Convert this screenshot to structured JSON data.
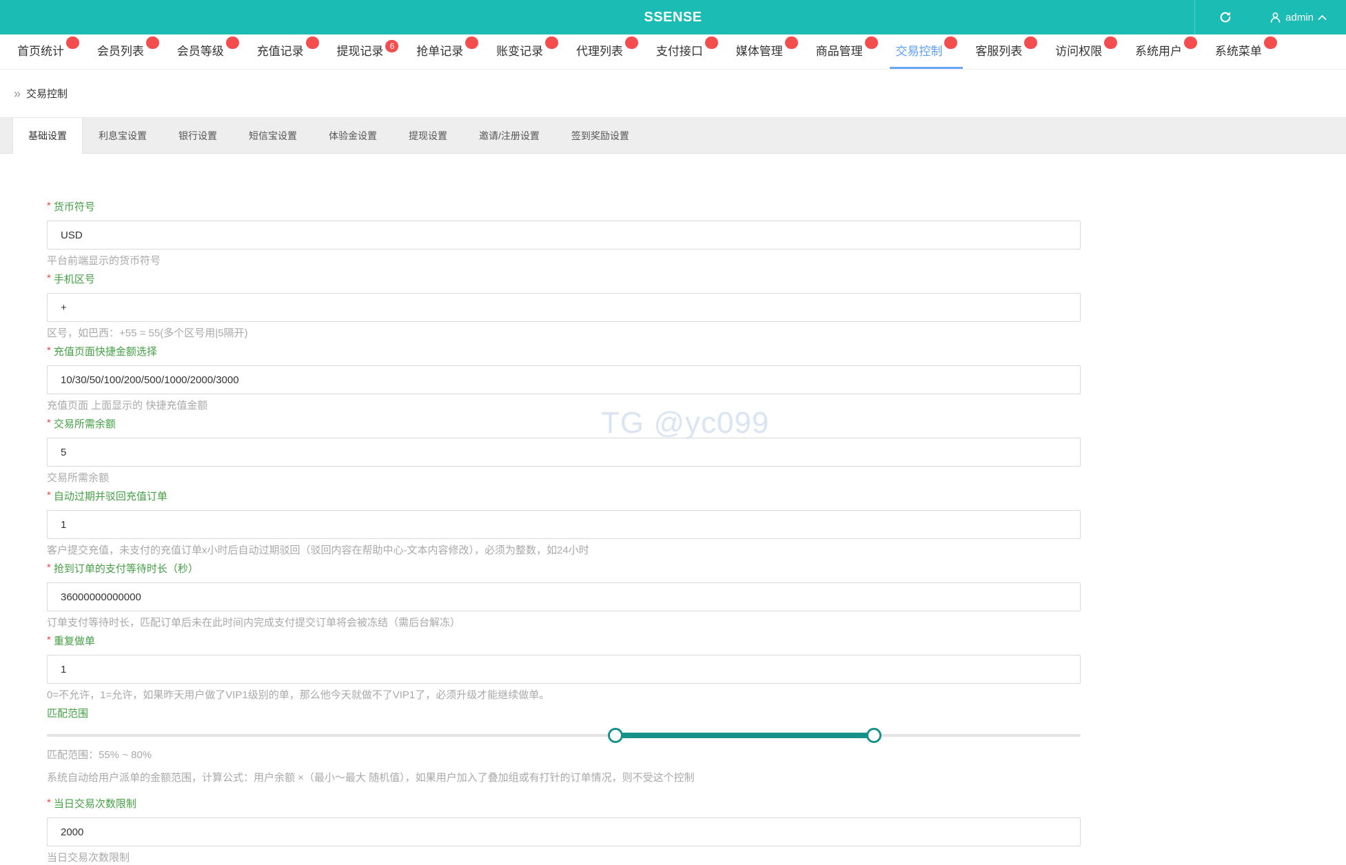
{
  "header": {
    "title": "SSENSE",
    "user": "admin"
  },
  "nav": {
    "active_index": 11,
    "items": [
      {
        "label": "首页统计"
      },
      {
        "label": "会员列表"
      },
      {
        "label": "会员等级"
      },
      {
        "label": "充值记录"
      },
      {
        "label": "提现记录",
        "badge": "6"
      },
      {
        "label": "抢单记录"
      },
      {
        "label": "账变记录"
      },
      {
        "label": "代理列表"
      },
      {
        "label": "支付接口"
      },
      {
        "label": "媒体管理"
      },
      {
        "label": "商品管理"
      },
      {
        "label": "交易控制"
      },
      {
        "label": "客服列表"
      },
      {
        "label": "访问权限"
      },
      {
        "label": "系统用户"
      },
      {
        "label": "系统菜单"
      }
    ]
  },
  "breadcrumb": {
    "label": "交易控制"
  },
  "tabs": {
    "active_index": 0,
    "items": [
      {
        "label": "基础设置"
      },
      {
        "label": "利息宝设置"
      },
      {
        "label": "银行设置"
      },
      {
        "label": "短信宝设置"
      },
      {
        "label": "体验金设置"
      },
      {
        "label": "提现设置"
      },
      {
        "label": "邀请/注册设置"
      },
      {
        "label": "签到奖励设置"
      }
    ]
  },
  "form": {
    "fields": [
      {
        "id": "currency-symbol",
        "type": "input",
        "required": true,
        "label": "货币符号",
        "value": "USD",
        "hint": "平台前端显示的货币符号"
      },
      {
        "id": "phone-area-code",
        "type": "input",
        "required": true,
        "label": "手机区号",
        "value": "+",
        "hint": "区号，如巴西：+55 = 55(多个区号用|5隔开)"
      },
      {
        "id": "quick-recharge-amounts",
        "type": "input",
        "required": true,
        "label": "充值页面快捷金额选择",
        "value": "10/30/50/100/200/500/1000/2000/3000",
        "hint": "充值页面 上面显示的 快捷充值金额"
      },
      {
        "id": "required-trade-balance",
        "type": "input",
        "required": true,
        "label": "交易所需余额",
        "value": "5",
        "hint": "交易所需余额"
      },
      {
        "id": "auto-expire-recharge-order",
        "type": "input",
        "required": true,
        "label": "自动过期并驳回充值订单",
        "value": "1",
        "hint": "客户提交充值，未支付的充值订单x小时后自动过期驳回（驳回内容在帮助中心-文本内容修改），必须为整数，如24小时"
      },
      {
        "id": "order-payment-wait-seconds",
        "type": "input",
        "required": true,
        "label": "抢到订单的支付等待时长（秒）",
        "value": "36000000000000",
        "hint": "订单支付等待时长，匹配订单后未在此时间内完成支付提交订单将会被冻结（需后台解冻）"
      },
      {
        "id": "repeat-order",
        "type": "input",
        "required": true,
        "label": "重复做单",
        "value": "1",
        "hint": "0=不允许，1=允许，如果昨天用户做了VIP1级别的单，那么他今天就做不了VIP1了，必须升级才能继续做单。"
      },
      {
        "id": "match-range",
        "type": "slider",
        "required": false,
        "label": "匹配范围",
        "min_percent": 55,
        "max_percent": 80,
        "hint": "匹配范围：55% ~ 80%",
        "hint2": "系统自动给用户派单的金额范围，计算公式：用户余额 ×（最小～最大 随机值），如果用户加入了叠加组或有打针的订单情况，则不受这个控制"
      },
      {
        "id": "daily-trade-limit",
        "type": "input",
        "required": true,
        "label": "当日交易次数限制",
        "value": "2000",
        "hint": "当日交易次数限制"
      }
    ]
  },
  "watermark": "TG @yc099",
  "colors": {
    "header_bg": "#1abcb4",
    "nav_active": "#5e9ef5",
    "label_green": "#44a044",
    "asterisk_red": "#e34d4d",
    "badge_red": "#f34d4d",
    "slider_fill": "#17928a",
    "watermark": "#dae4f2"
  }
}
